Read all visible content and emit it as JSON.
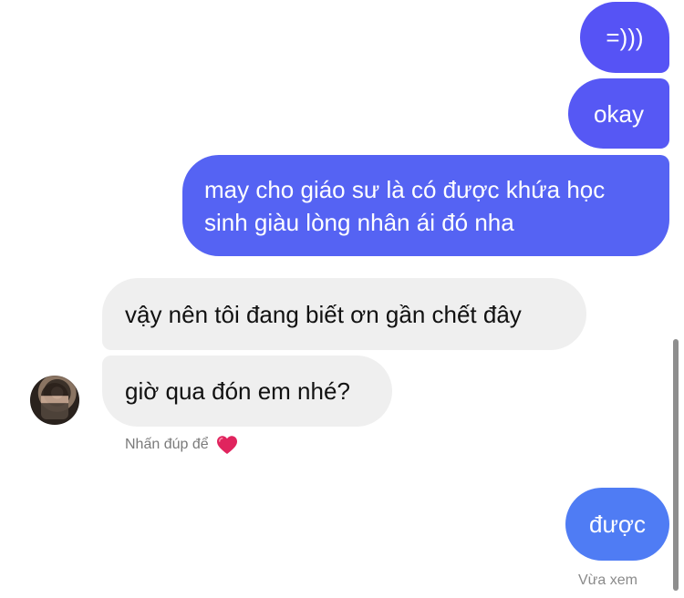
{
  "messages": {
    "sent_1": "=)))",
    "sent_2": "okay",
    "sent_3": "may cho giáo sư là có được khứa học sinh giàu lòng nhân ái đó nha",
    "received_1": "vậy nên tôi đang biết ơn gần chết đây",
    "received_2": "giờ qua đón em nhé?",
    "sent_4": "được"
  },
  "reaction_hint": {
    "text": "Nhấn đúp để",
    "icon": "heart-icon"
  },
  "seen_status": "Vừa xem",
  "avatar": {
    "icon": "user-avatar"
  },
  "colors": {
    "sent_bubble_top": "#5653f5",
    "sent_bubble_bottom": "#4f7cf4",
    "received_bubble": "#efefef",
    "heart": "#e0245e",
    "muted_text": "#7a7a7a"
  }
}
